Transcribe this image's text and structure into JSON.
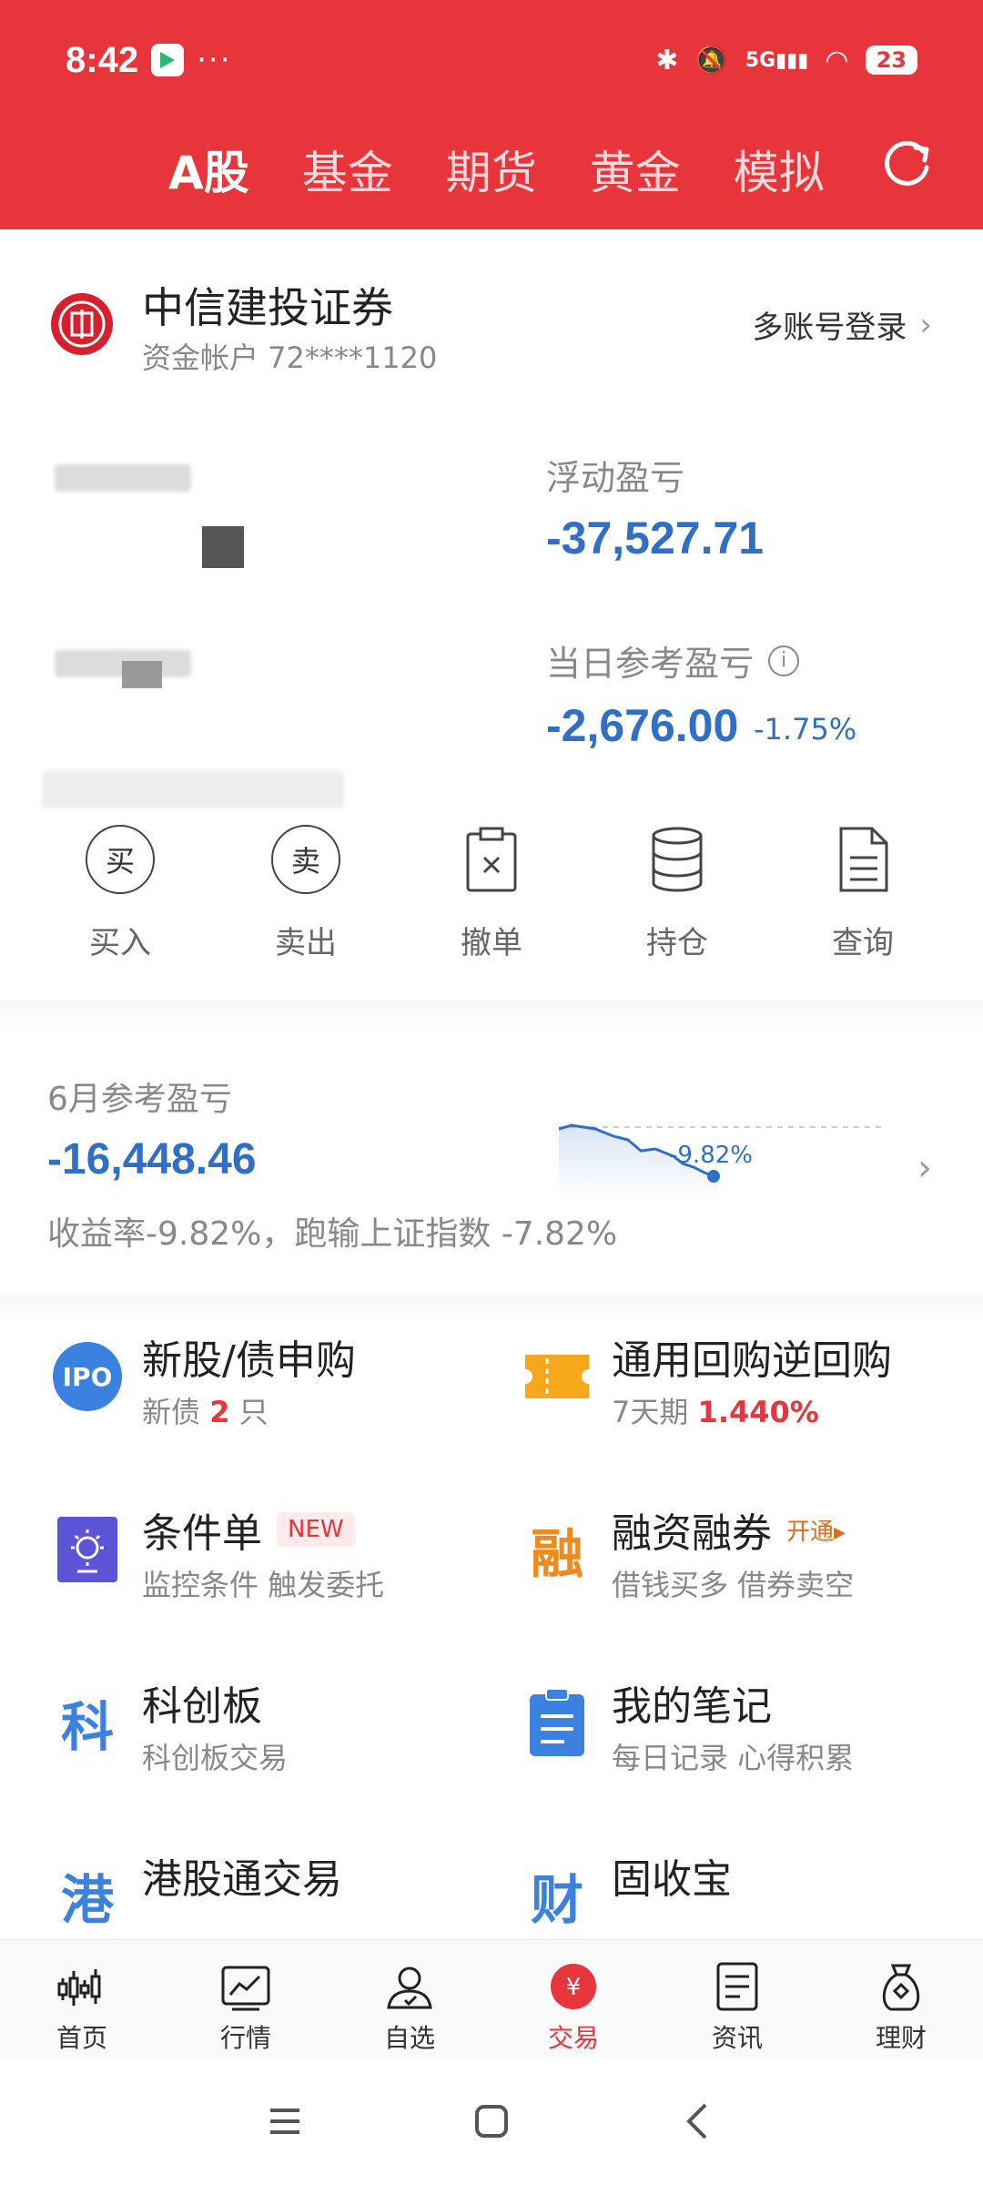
{
  "status_bar": {
    "time": "8:42",
    "dots": "···",
    "network": "5G",
    "battery": "23"
  },
  "tabs": [
    {
      "label": "A股",
      "active": true
    },
    {
      "label": "基金",
      "active": false
    },
    {
      "label": "期货",
      "active": false
    },
    {
      "label": "黄金",
      "active": false
    },
    {
      "label": "模拟",
      "active": false
    }
  ],
  "account": {
    "broker_name": "中信建投证券",
    "account_label": "资金帐户 72****1120",
    "multi_login": "多账号登录",
    "floating_pl_label": "浮动盈亏",
    "floating_pl_value": "-37,527.71",
    "today_pl_label": "当日参考盈亏",
    "today_pl_value": "-2,676.00",
    "today_pl_pct": "-1.75%"
  },
  "actions": [
    {
      "label": "买入",
      "icon": "buy-icon",
      "glyph": "买"
    },
    {
      "label": "卖出",
      "icon": "sell-icon",
      "glyph": "卖"
    },
    {
      "label": "撤单",
      "icon": "cancel-order-icon"
    },
    {
      "label": "持仓",
      "icon": "holdings-icon"
    },
    {
      "label": "查询",
      "icon": "query-icon"
    }
  ],
  "monthly": {
    "label": "6月参考盈亏",
    "value": "-16,448.46",
    "desc": "收益率-9.82%，跑输上证指数 -7.82%",
    "spark_label": "-9.82%"
  },
  "services": [
    {
      "title": "新股/债申购",
      "sub_prefix": "新债 ",
      "sub_num": "2",
      "sub_suffix": " 只",
      "icon": "ipo-icon",
      "glyph": "IPO"
    },
    {
      "title": "通用回购逆回购",
      "sub_prefix": "7天期 ",
      "sub_num": "1.440%",
      "sub_suffix": "",
      "icon": "ticket-icon"
    },
    {
      "title": "条件单",
      "badge": "NEW",
      "sub": "监控条件 触发委托",
      "icon": "condition-order-icon"
    },
    {
      "title": "融资融券",
      "badge": "开通▸",
      "sub": "借钱买多 借券卖空",
      "icon": "margin-icon",
      "glyph": "融"
    },
    {
      "title": "科创板",
      "sub": "科创板交易",
      "icon": "star-market-icon",
      "glyph": "科"
    },
    {
      "title": "我的笔记",
      "sub": "每日记录 心得积累",
      "icon": "notes-icon"
    },
    {
      "title": "港股通交易",
      "icon": "hk-connect-icon",
      "glyph": "港"
    },
    {
      "title": "固收宝",
      "icon": "fixed-income-icon",
      "glyph": "财"
    }
  ],
  "bottom_nav": [
    {
      "label": "首页",
      "icon": "home-icon",
      "active": false
    },
    {
      "label": "行情",
      "icon": "market-icon",
      "active": false
    },
    {
      "label": "自选",
      "icon": "watchlist-icon",
      "active": false
    },
    {
      "label": "交易",
      "icon": "trade-icon",
      "active": true
    },
    {
      "label": "资讯",
      "icon": "news-icon",
      "active": false
    },
    {
      "label": "理财",
      "icon": "wealth-icon",
      "active": false
    }
  ],
  "colors": {
    "brand_red": "#e8343b",
    "loss_blue": "#2f6fc6"
  }
}
